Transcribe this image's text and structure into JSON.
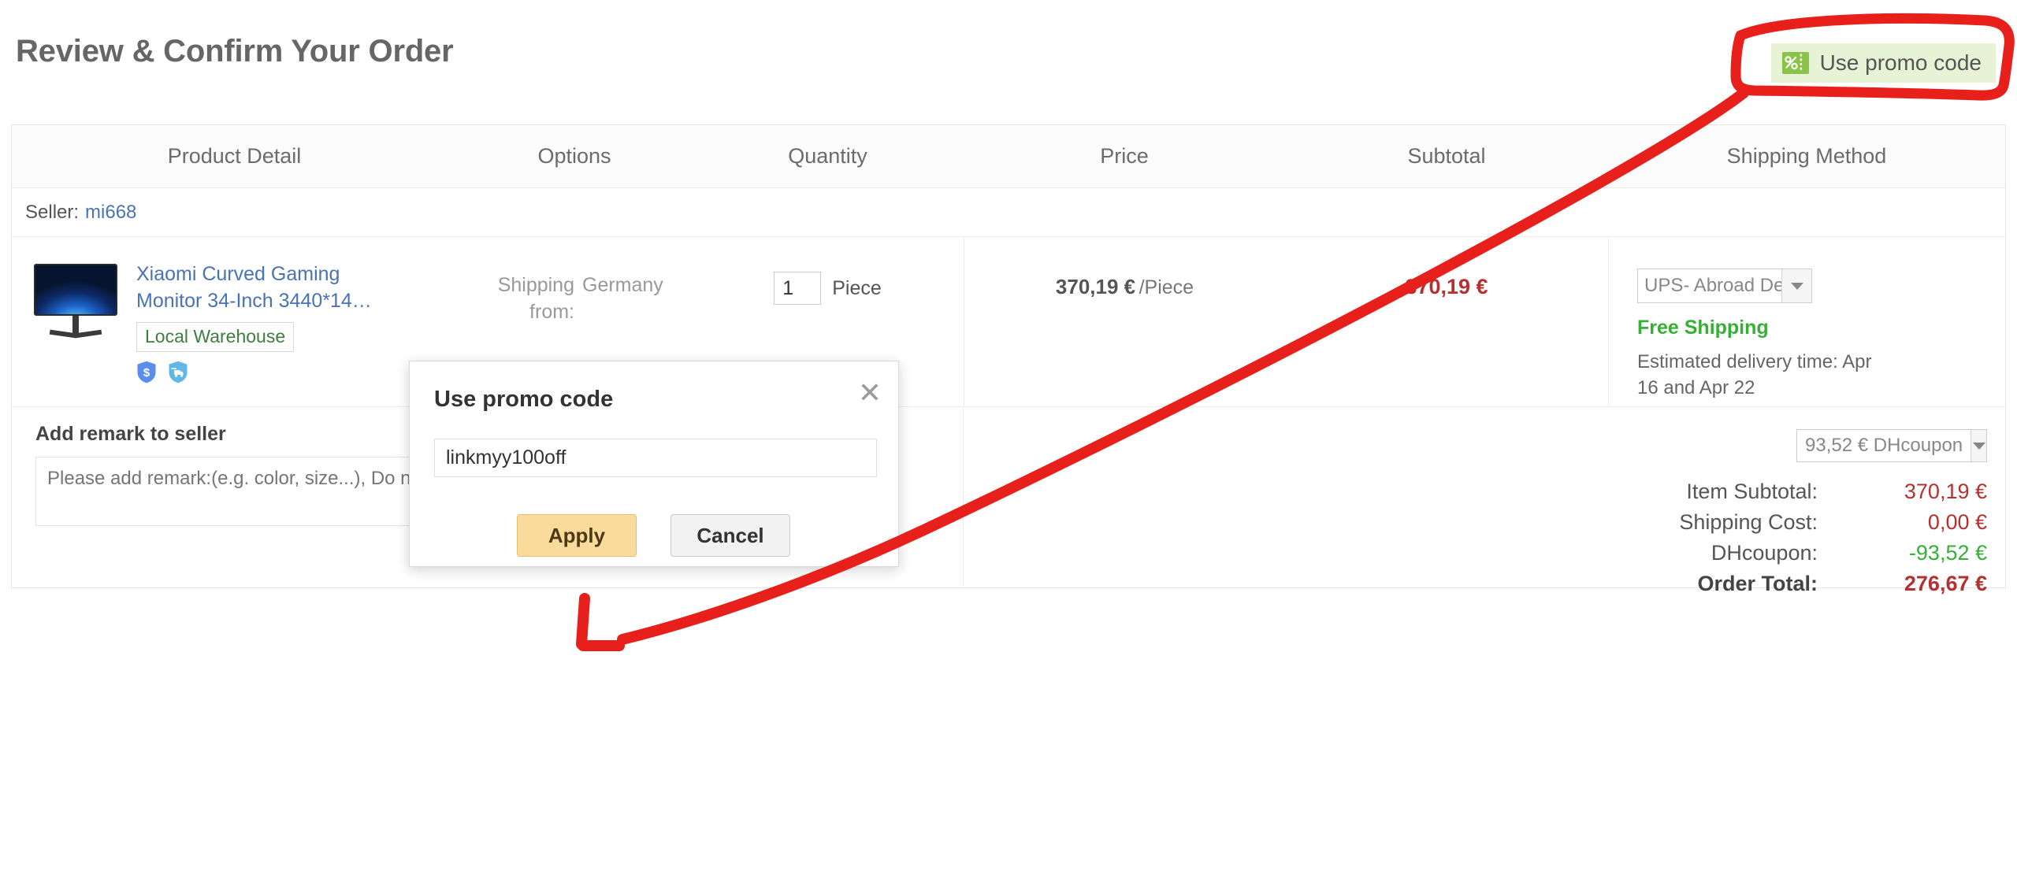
{
  "header": {
    "title": "Review & Confirm Your Order",
    "promo_button_label": "Use promo code",
    "promo_icon": "percent-coupon-icon"
  },
  "table": {
    "columns": [
      "Product Detail",
      "Options",
      "Quantity",
      "Price",
      "Subtotal",
      "Shipping Method"
    ],
    "seller_label": "Seller:",
    "seller_name": "mi668",
    "item": {
      "title": "Xiaomi Curved Gaming Monitor 34-Inch 3440*14…",
      "image_alt": "curved-gaming-monitor-image",
      "warehouse_tag": "Local Warehouse",
      "badges": [
        "buyer-protection-shield-icon",
        "shipping-guarantee-shield-icon"
      ],
      "ship_from_label": "Shipping from:",
      "ship_from_value": "Germany",
      "quantity": "1",
      "quantity_unit": "Piece",
      "price": "370,19 €",
      "price_unit": "/Piece",
      "subtotal": "370,19 €",
      "shipping_method": "UPS- Abroad Delive",
      "free_shipping": "Free Shipping",
      "eta": "Estimated delivery time: Apr 16 and Apr 22"
    }
  },
  "remark": {
    "title": "Add remark to seller",
    "placeholder": "Please add remark:(e.g. color, size...), Do not enter <>&",
    "value": ""
  },
  "summary": {
    "coupon_select": "93,52 € DHcoupon",
    "lines": [
      {
        "label": "Item Subtotal:",
        "value": "370,19 €"
      },
      {
        "label": "Shipping Cost:",
        "value": "0,00 €"
      },
      {
        "label": "DHcoupon:",
        "value": "-93,52 €"
      },
      {
        "label": "Order Total:",
        "value": "276,67 €"
      }
    ]
  },
  "dialog": {
    "title": "Use promo code",
    "close_icon": "close-icon",
    "input_value": "linkmyy100off",
    "input_placeholder": "",
    "apply_label": "Apply",
    "cancel_label": "Cancel"
  },
  "colors": {
    "price_red": "#b53030",
    "discount_green": "#35b035",
    "free_shipping_green": "#35b035",
    "link_blue": "#4a73b5",
    "promo_bg": "#e7f3d5",
    "promo_icon_green": "#8bc34a",
    "apply_amber": "#fbdb9b",
    "annotation_red": "#e8201c"
  }
}
